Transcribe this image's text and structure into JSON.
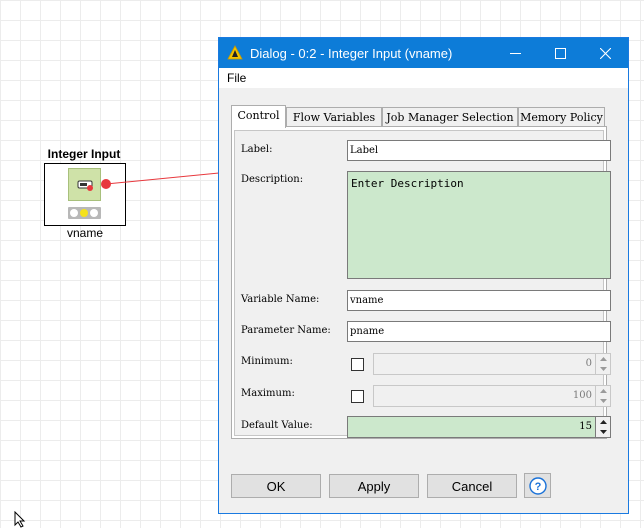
{
  "workflow": {
    "node": {
      "title": "Integer Input",
      "label": "vname",
      "icon": "integer-input-icon",
      "status_colors": [
        "#ffffff",
        "#f5e21b",
        "#ffffff"
      ],
      "port_color": "#e8383d"
    }
  },
  "dialog": {
    "title": "Dialog - 0:2 - Integer Input (vname)",
    "titlebar_color": "#0d7cd8",
    "menu": {
      "file": "File"
    },
    "tabs": [
      {
        "label": "Control",
        "active": true
      },
      {
        "label": "Flow Variables",
        "active": false
      },
      {
        "label": "Job Manager Selection",
        "active": false
      },
      {
        "label": "Memory Policy",
        "active": false
      }
    ],
    "form": {
      "label": {
        "label": "Label:",
        "value": "Label"
      },
      "description": {
        "label": "Description:",
        "value": "Enter Description"
      },
      "variable_name": {
        "label": "Variable Name:",
        "value": "vname"
      },
      "parameter_name": {
        "label": "Parameter Name:",
        "value": "pname"
      },
      "minimum": {
        "label": "Minimum:",
        "checked": false,
        "value": "0"
      },
      "maximum": {
        "label": "Maximum:",
        "checked": false,
        "value": "100"
      },
      "default_value": {
        "label": "Default Value:",
        "value": "15"
      }
    },
    "buttons": {
      "ok": "OK",
      "apply": "Apply",
      "cancel": "Cancel",
      "help_icon": "question-icon"
    }
  }
}
